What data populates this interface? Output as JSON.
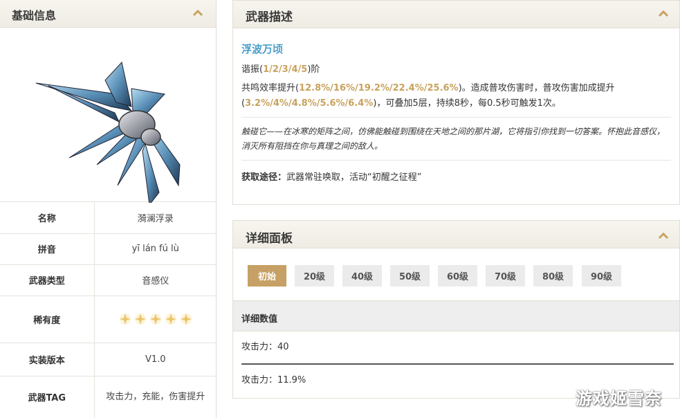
{
  "basic": {
    "title": "基础信息",
    "rows": [
      {
        "key": "名称",
        "value": "漪澜浮录"
      },
      {
        "key": "拼音",
        "value": "yī lán fú lù"
      },
      {
        "key": "武器类型",
        "value": "音感仪"
      },
      {
        "key": "稀有度",
        "value": ""
      },
      {
        "key": "实装版本",
        "value": "V1.0"
      },
      {
        "key": "武器TAG",
        "value": "攻击力，充能，伤害提升"
      }
    ],
    "rarity_stars": 5
  },
  "description": {
    "title": "武器描述",
    "weapon_name": "浮波万顷",
    "refine_prefix": "谐振(",
    "refine_levels": "1/2/3/4/5",
    "refine_suffix": ")阶",
    "effect": {
      "p1": "共鸣效率提升(",
      "v1": "12.8%/16%/19.2%/22.4%/25.6%",
      "p2": ")。造成普攻伤害时，普攻伤害加成提升(",
      "v2": "3.2%/4%/4.8%/5.6%/6.4%",
      "p3": ")，可叠加5层，持续8秒，每0.5秒可触发1次。"
    },
    "flavor": "触碰它——在冰寒的矩阵之间，仿佛能触碰到围绕在天地之间的那片湖，它将指引你找到一切答案。怀抱此音感仪，消灭所有阻挡在你与真理之间的敌人。",
    "obtain_label": "获取途径：",
    "obtain_value": "武器常驻唤取，活动“初醒之征程”"
  },
  "detail": {
    "title": "详细面板",
    "levels": [
      "初始",
      "20级",
      "40级",
      "50级",
      "60级",
      "70级",
      "80级",
      "90级"
    ],
    "active_level": "初始",
    "stats_header": "详细数值",
    "stat1": "攻击力：40",
    "stat2": "攻击力：11.9%"
  },
  "watermark": "游戏姬雪奈",
  "colors": {
    "accent_gold": "#c6a064",
    "weapon_name_blue": "#4a9ec9"
  }
}
